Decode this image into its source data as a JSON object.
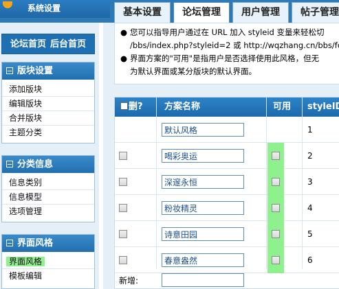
{
  "header": {
    "logo_text": "系统设置",
    "tabs": [
      {
        "label": "基本设置",
        "active": false
      },
      {
        "label": "论坛管理",
        "active": true
      },
      {
        "label": "用户管理",
        "active": false
      },
      {
        "label": "帖子管理",
        "active": false
      }
    ]
  },
  "sidebar": {
    "links": [
      "论坛首页",
      "后台首页"
    ],
    "panels": [
      {
        "title": "版块设置",
        "items": [
          "添加版块",
          "编辑版块",
          "合并版块",
          "主题分类"
        ]
      },
      {
        "title": "分类信息",
        "items": [
          "信息类别",
          "信息模型",
          "选项管理"
        ]
      },
      {
        "title": "界面风格",
        "items": [
          "界面风格",
          "模板编辑"
        ],
        "selected_index": 0
      }
    ]
  },
  "notes": {
    "line1": "您可以指导用户通过在 URL 加入 styleid 变量来轻松切",
    "line2": "/bbs/index.php?styleid=2 或 http://wqzhang.cn/bbs/fo",
    "line3": "界面方案的\"可用\"是指用户是否选择使用此风格，但无",
    "line4": "为默认界面或某分版块的默认界面。"
  },
  "table": {
    "headers": {
      "del": "删?",
      "name": "方案名称",
      "avail": "可用",
      "id": "styleID"
    },
    "rows": [
      {
        "name": "默认风格",
        "id": "1",
        "has_checkbox": false
      },
      {
        "name": "喝彩奥运",
        "id": "2",
        "has_checkbox": true
      },
      {
        "name": "深邃永恒",
        "id": "3",
        "has_checkbox": true
      },
      {
        "name": "粉妆精灵",
        "id": "4",
        "has_checkbox": true
      },
      {
        "name": "诗意田园",
        "id": "5",
        "has_checkbox": true
      },
      {
        "name": "春意盎然",
        "id": "6",
        "has_checkbox": true
      }
    ],
    "new_label": "新增:",
    "new_value": ""
  },
  "colors": {
    "highlight": "#92f091",
    "header_blue": "#1f70b3",
    "sidebar_bg": "#e4eff8"
  }
}
